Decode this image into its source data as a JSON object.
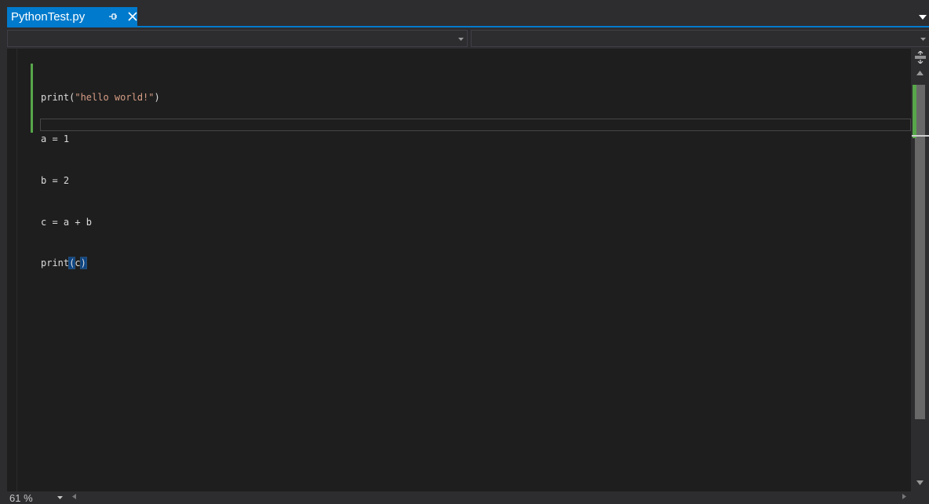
{
  "tab": {
    "title": "PythonTest.py",
    "pin_icon": "pin-icon",
    "close_icon": "close-icon"
  },
  "navbar": {
    "left_dropdown_value": "",
    "right_dropdown_value": ""
  },
  "editor": {
    "lines": [
      "print(\"hello world!\")",
      "a = 1",
      "b = 2",
      "c = a + b",
      "print(c)"
    ],
    "current_line": 5
  },
  "statusbar": {
    "zoom": "61 %"
  },
  "colors": {
    "accent": "#007acc",
    "editor_bg": "#1e1e1e",
    "chrome_bg": "#2d2d30",
    "string": "#d69d85",
    "text": "#dcdcdc",
    "change_marker": "#57a64a",
    "brace_highlight": "#0e4583"
  }
}
